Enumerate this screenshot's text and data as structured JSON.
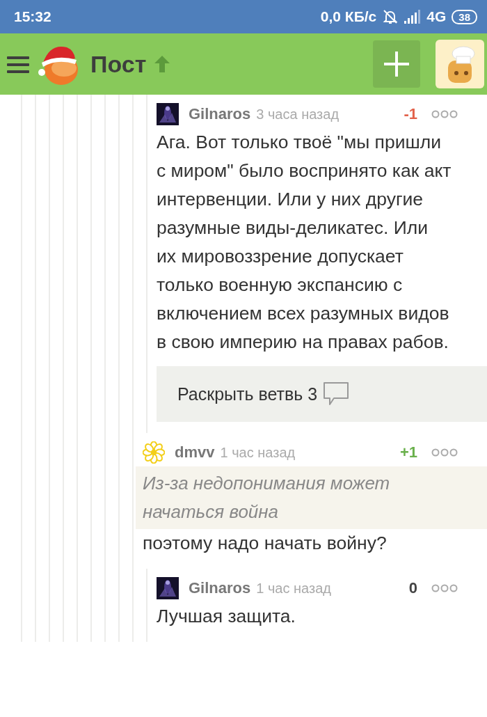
{
  "status_bar": {
    "time": "15:32",
    "speed": "0,0 КБ/с",
    "network": "4G",
    "battery": "38"
  },
  "header": {
    "title": "Пост"
  },
  "comments": [
    {
      "children": [
        {
          "author": "Gilnaros",
          "time": "3 часа назад",
          "rating": "-1",
          "color": "#e2614a",
          "body": "Ага. Вот только твоё \"мы пришли с миром\" было воспринято как акт интервенции. Или у них другие разумные виды-деликатес. Или их мировоззрение допускает только военную экспансию с включением всех разумных видов в свою империю на правах рабов.",
          "expand": {
            "label": "Раскрыть ветвь 3"
          }
        }
      ]
    },
    {
      "author": "dmvv",
      "avatar": {
        "kind": "flower"
      },
      "time": "1 час назад",
      "rating": "+1",
      "color": "#6ab04c",
      "quote": "Из-за недопонимания может начаться война",
      "body": "поэтому надо начать войну?",
      "children": [
        {
          "author": "Gilnaros",
          "time": "1 час назад",
          "rating": "0",
          "color": "#444444",
          "body": "Лучшая защита."
        }
      ]
    }
  ]
}
